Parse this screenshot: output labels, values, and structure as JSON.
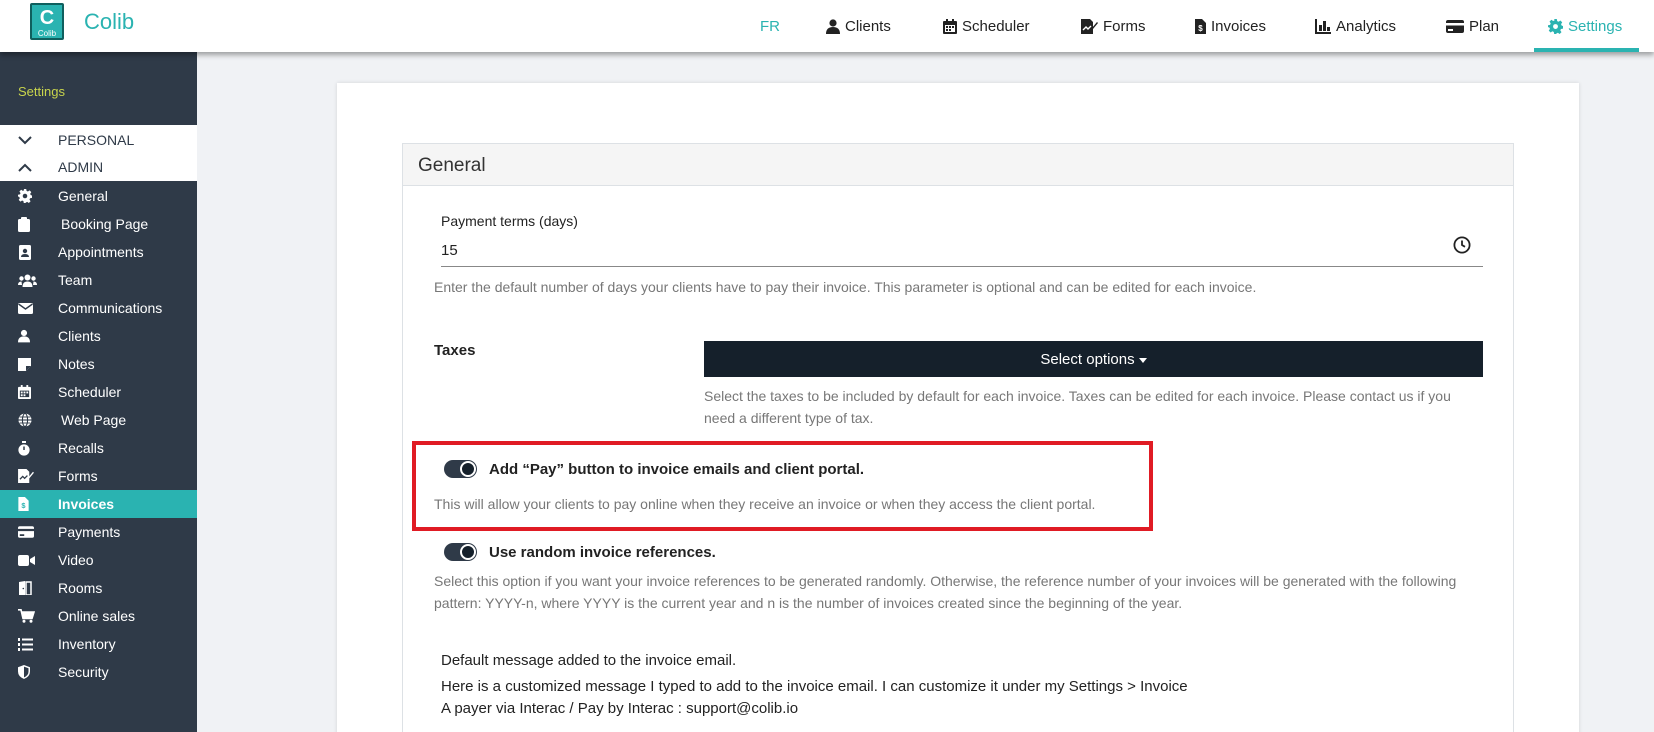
{
  "header": {
    "logo_letter": "C",
    "logo_small": "Colib",
    "brand": "Colib",
    "lang": "FR",
    "nav": [
      "Clients",
      "Scheduler",
      "Forms",
      "Invoices",
      "Analytics",
      "Plan",
      "Settings"
    ],
    "active_nav": "Settings"
  },
  "sidebar": {
    "title": "Settings",
    "sections": [
      "PERSONAL",
      "ADMIN"
    ],
    "items": [
      "General",
      "Booking Page",
      "Appointments",
      "Team",
      "Communications",
      "Clients",
      "Notes",
      "Scheduler",
      "Web Page",
      "Recalls",
      "Forms",
      "Invoices",
      "Payments",
      "Video",
      "Rooms",
      "Online sales",
      "Inventory",
      "Security"
    ],
    "active_item": "Invoices"
  },
  "panel": {
    "title": "General",
    "payment_terms": {
      "label": "Payment terms (days)",
      "value": "15",
      "help": "Enter the default number of days your clients have to pay their invoice. This parameter is optional and can be edited for each invoice."
    },
    "taxes": {
      "label": "Taxes",
      "button": "Select options",
      "help": "Select the taxes to be included by default for each invoice. Taxes can be edited for each invoice. Please contact us if you need a different type of tax."
    },
    "pay_button": {
      "label": "Add “Pay” button to invoice emails and client portal.",
      "help": "This will allow your clients to pay online when they receive an invoice or when they access the client portal.",
      "enabled": true
    },
    "random_refs": {
      "label": "Use random invoice references.",
      "help": "Select this option if you want your invoice references to be generated randomly. Otherwise, the reference number of your invoices will be generated with the following pattern: YYYY-n, where YYYY is the current year and n is the number of invoices created since the beginning of the year.",
      "enabled": true
    },
    "default_message": {
      "label": "Default message added to the invoice email.",
      "lines": [
        "Here is a customized message I typed to add to the invoice email. I can customize it under my Settings > Invoice",
        "A payer via Interac / Pay by Interac : support@colib.io"
      ]
    }
  },
  "colors": {
    "accent": "#2ab3b1",
    "sidebar_bg": "#2f3a48",
    "dark_button": "#15202b",
    "highlight": "#e01b24"
  }
}
